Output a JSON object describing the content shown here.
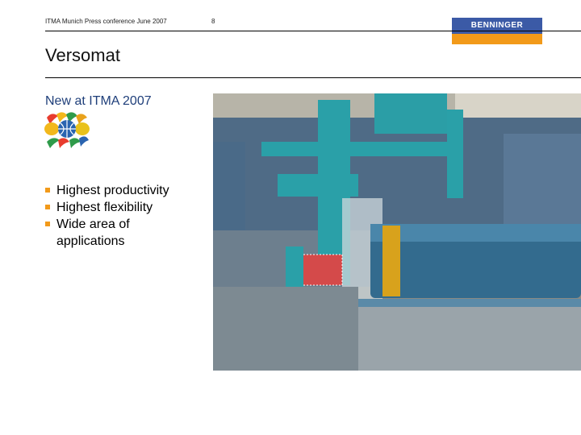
{
  "header": {
    "text": "ITMA Munich Press conference June 2007",
    "page": "8"
  },
  "logo": {
    "text": "BENNINGER",
    "colors": {
      "top": "#3b5aa6",
      "bottom": "#f29a1a"
    }
  },
  "title": "Versomat",
  "subtitle": "New at ITMA 2007",
  "bullets": [
    "Highest productivity",
    "Highest flexibility",
    "Wide area of applications"
  ],
  "colors": {
    "bullet": "#f29a1a",
    "subtitle": "#1f3f7a"
  }
}
